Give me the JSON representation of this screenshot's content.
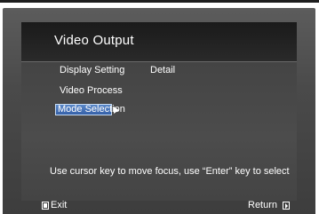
{
  "menu": {
    "title": "Video Output",
    "items": [
      {
        "label": "Display Setting",
        "value": "Detail"
      },
      {
        "label": "Video Process",
        "value": ""
      },
      {
        "label": "Mode Selection",
        "value": ""
      }
    ],
    "selected_index": 2
  },
  "help": {
    "text": "Use cursor key to move focus, use “Enter” key to select"
  },
  "footer": {
    "exit_label": "Exit",
    "return_label": "Return",
    "exit_icon": "exit-button-icon",
    "return_icon": "return-button-icon"
  },
  "colors": {
    "highlight": "#3f6cb4",
    "text": "#ffffff",
    "background": "#4a4a4a"
  }
}
